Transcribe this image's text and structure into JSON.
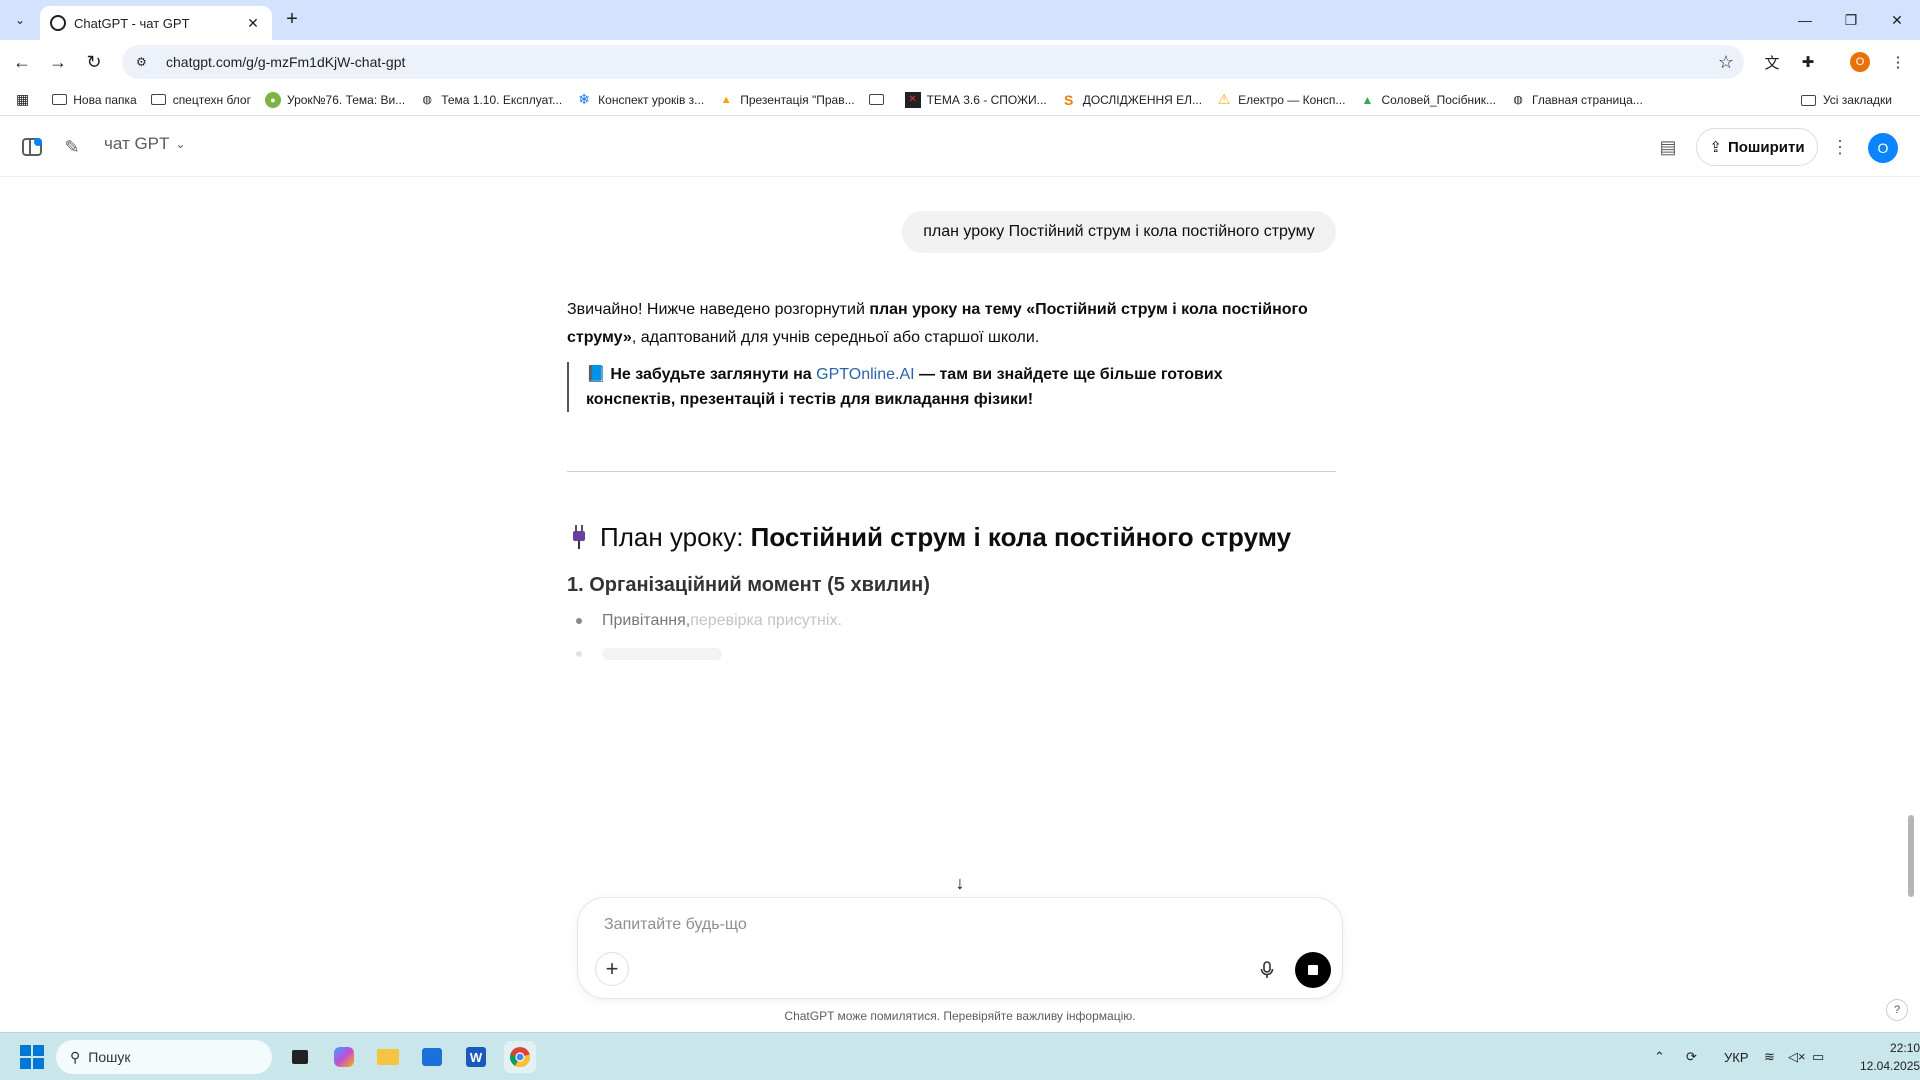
{
  "browser": {
    "tab_title": "ChatGPT - чат GPT",
    "url": "chatgpt.com/g/g-mzFm1dKjW-chat-gpt",
    "profile_initial": "O",
    "bookmarks": [
      {
        "label": "Нова папка",
        "icon": "folder-icon"
      },
      {
        "label": "спецтехн блог",
        "icon": "folder-icon"
      },
      {
        "label": "Урок№76. Тема: Ви...",
        "icon": "site-icon"
      },
      {
        "label": "Тема 1.10. Експлуат...",
        "icon": "globe-icon"
      },
      {
        "label": "Конспект уроків з...",
        "icon": "snowflake-icon"
      },
      {
        "label": "Презентація \"Прав...",
        "icon": "warning-icon"
      },
      {
        "label": "",
        "icon": "folder-icon"
      },
      {
        "label": "ТЕМА 3.6 - СПОЖИ...",
        "icon": "site-icon"
      },
      {
        "label": "ДОСЛІДЖЕННЯ ЕЛ...",
        "icon": "s-icon"
      },
      {
        "label": "Електро — Консп...",
        "icon": "warning-icon"
      },
      {
        "label": "Соловей_Посібник...",
        "icon": "drive-icon"
      },
      {
        "label": "Главная страница...",
        "icon": "globe-icon"
      }
    ],
    "all_bookmarks": "Усі закладки"
  },
  "header": {
    "model_title": "чат GPT",
    "share_label": "Поширити",
    "avatar_initial": "О"
  },
  "conversation": {
    "user_message": "план уроку Постійний струм і кола постійного струму",
    "answer": {
      "intro_plain_1": "Звичайно! Нижче наведено розгорнутий ",
      "intro_bold": "план уроку на тему «Постійний струм і кола постійного струму»",
      "intro_plain_2": ", адаптований для учнів середньої або старшої школи.",
      "quote_emoji": "📘",
      "quote_pre": "Не забудьте заглянути на ",
      "quote_link": "GPTOnline.AI",
      "quote_post": " — там ви знайдете ще більше готових конспектів, презентацій і тестів для викладання фізики!",
      "h2_plain": "План уроку: ",
      "h2_bold": "Постійний струм і кола постійного струму",
      "h3": "1. Організаційний момент (5 хвилин)",
      "list_item_1a": "Привітання, ",
      "list_item_1b": "перевірка присутніх."
    }
  },
  "composer": {
    "placeholder": "Запитайте будь-що",
    "disclaimer": "ChatGPT може помилятися. Перевіряйте важливу інформацію.",
    "help": "?"
  },
  "taskbar": {
    "search_label": "Пошук",
    "language": "УКР",
    "time": "22:10",
    "date": "12.04.2025"
  },
  "colors": {
    "accent_blue": "#0285ff",
    "link": "#2964aa",
    "tab_strip": "#d3e3fd",
    "taskbar": "#c9e6ea"
  }
}
